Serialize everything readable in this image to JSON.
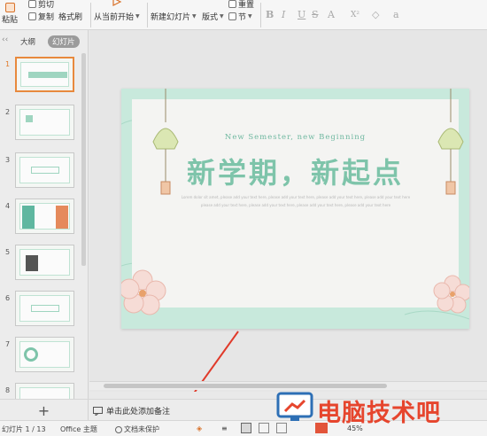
{
  "ribbon": {
    "paste": "粘贴",
    "cut": "剪切",
    "copy": "复制",
    "format_painter": "格式刷",
    "play_from_current": "从当前开始",
    "new_slide": "新建幻灯片",
    "layout": "版式",
    "reset": "重置",
    "section": "节",
    "fmt_bold": "B",
    "fmt_italic": "I",
    "fmt_underline": "U",
    "fmt_strike": "S",
    "fmt_font_color": "A"
  },
  "panel": {
    "tab_outline": "大纲",
    "tab_slides": "幻灯片",
    "slide_numbers": [
      "1",
      "2",
      "3",
      "4",
      "5",
      "6",
      "7",
      "8"
    ],
    "add_slide": "+"
  },
  "slide": {
    "subtitle": "New Semester, new Beginning",
    "title": "新学期，新起点",
    "body_line1": "Lorem dolor sit amet, please add your text here, please add your text here, please add your text here, please add your text here",
    "body_line2": "please add your text here, please add your text here, please add your text here, please add your text here"
  },
  "notes": {
    "placeholder": "单击此处添加备注"
  },
  "status": {
    "slide_counter": "幻灯片 1 / 13",
    "theme": "Office 主题",
    "protection": "文档未保护",
    "zoom": "45%",
    "zoom_percent": 45
  },
  "watermark": {
    "text": "电脑技术吧"
  },
  "colors": {
    "accent_orange": "#e8893d",
    "slide_green": "#7ec4aa",
    "watermark_red": "#e6452d"
  }
}
